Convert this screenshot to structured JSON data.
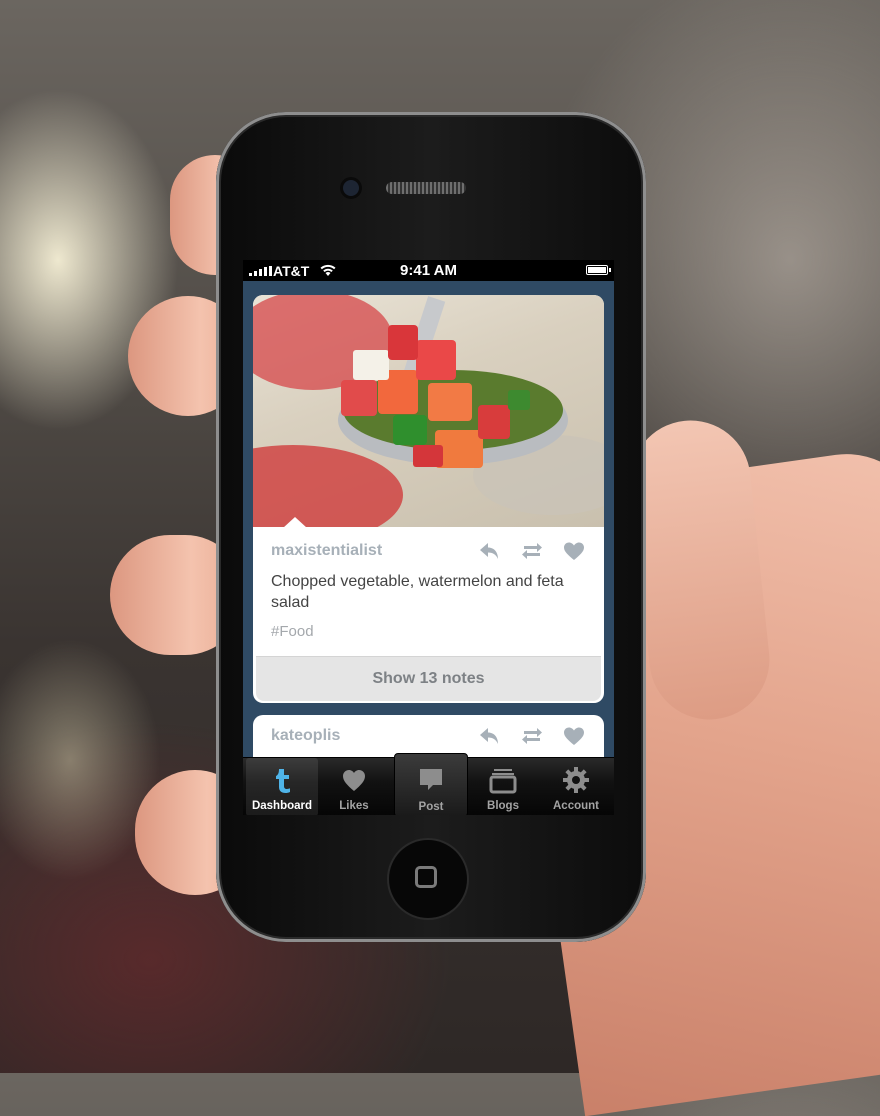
{
  "status_bar": {
    "carrier": "AT&T",
    "time": "9:41 AM"
  },
  "posts": [
    {
      "username": "maxistentialist",
      "caption": "Chopped vegetable, watermelon and feta salad",
      "tag": "#Food",
      "notes_button": "Show 13 notes"
    },
    {
      "username": "kateoplis"
    }
  ],
  "tab_bar": {
    "tabs": [
      {
        "label": "Dashboard",
        "icon": "tumblr-t-icon",
        "active": true
      },
      {
        "label": "Likes",
        "icon": "heart-icon"
      },
      {
        "label": "Post",
        "icon": "speech-bubble-icon"
      },
      {
        "label": "Blogs",
        "icon": "stacked-folders-icon"
      },
      {
        "label": "Account",
        "icon": "gear-icon"
      }
    ]
  },
  "colors": {
    "dashboard_background": "#2f4a64",
    "username_gray": "#a7b0b8",
    "active_tab_icon": "#4fb4e8"
  }
}
